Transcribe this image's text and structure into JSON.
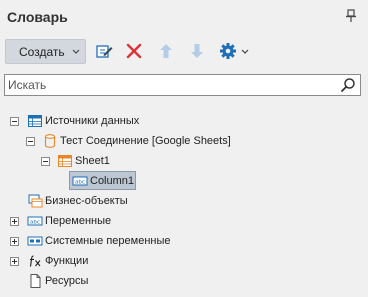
{
  "panel": {
    "title": "Словарь"
  },
  "toolbar": {
    "create_label": "Создать"
  },
  "search": {
    "placeholder": "Искать",
    "value": ""
  },
  "tree": {
    "data_sources": "Источники данных",
    "connection": "Тест Соединение [Google Sheets]",
    "sheet": "Sheet1",
    "column": "Column1",
    "business_objects": "Бизнес-объекты",
    "variables": "Переменные",
    "system_variables": "Системные переменные",
    "functions": "Функции",
    "resources": "Ресурсы"
  },
  "colors": {
    "background": "#f0f0f0",
    "button": "#d3d8de",
    "selection": "#bcc7d3",
    "delete_red": "#e0313b",
    "accent_blue": "#1f6fb8",
    "arrow_disabled": "#b4cde6",
    "data_orange": "#e8872a"
  }
}
